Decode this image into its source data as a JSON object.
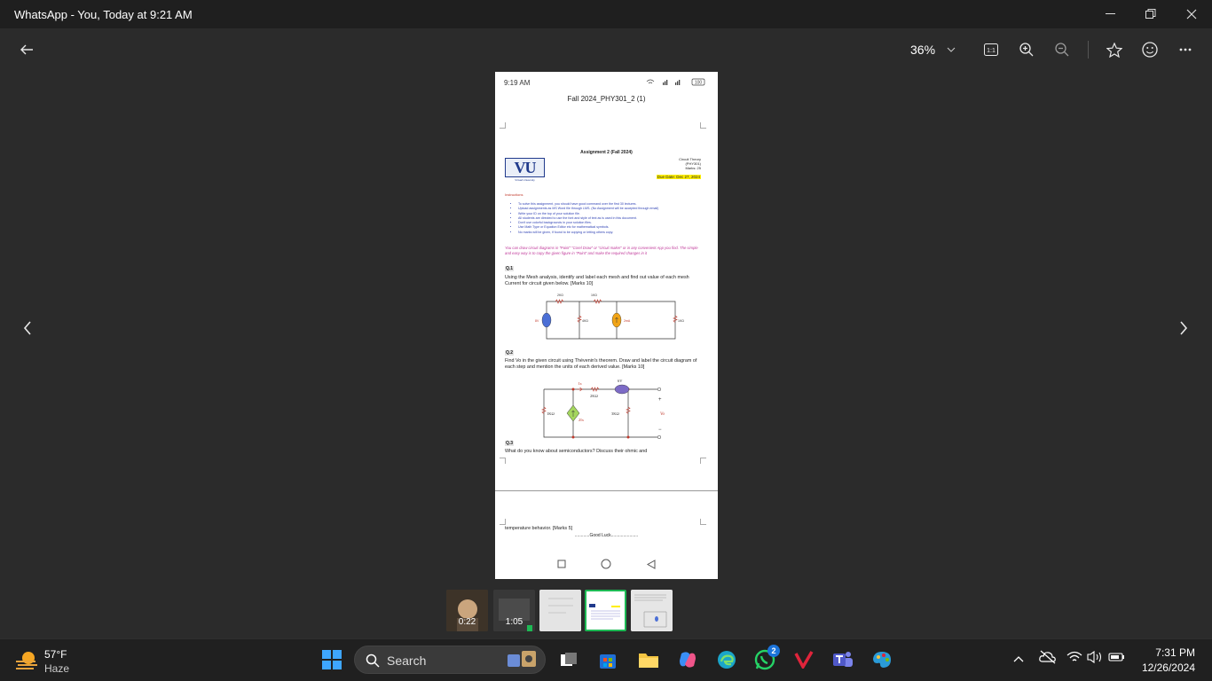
{
  "window": {
    "title": "WhatsApp - You, Today at 9:21 AM"
  },
  "toolbar": {
    "zoom": "36%"
  },
  "phone": {
    "time": "9:19 AM",
    "battery": "100",
    "doc_title": "Fall 2024_PHY301_2 (1)",
    "assignment_title": "Assignment 2 (Fall 2024)",
    "logo_text": "VU",
    "logo_sub": "Virtual University",
    "course": [
      "Circuit Theory",
      "(PHY301)",
      "Marks: 25"
    ],
    "due": "Due Date: Dec 27, 2024",
    "instructions_heading": "Instructions",
    "instructions": [
      "To solve this assignment, you should have good command over the first 30 lectures.",
      "Upload assignments as MS Word file through LMS. (No Assignment will be accepted through email)",
      "Write your ID on the top of your solution file.",
      "All students are directed to use the font and style of text as is used in this document.",
      "Don't use colorful backgrounds in your solution files.",
      "Use Math Type or Equation Editor etc for mathematical symbols.",
      "No marks will be given, if found to be copying or letting others copy."
    ],
    "note": "You can draw circuit diagrams in \"Paint\" \"Corel Draw\" or \"circuit maker\" or in any convenient App you find. The simple and easy way is to copy the given figure in \"Paint\" and make the required changes in it",
    "q1_heading": "Q.1",
    "q1_text": "Using the Mesh analysis, identify and label each mesh and find out value of each mesh Current for circuit given below.                  [Marks 10]",
    "c1": {
      "r1": "2KΩ",
      "r2": "1KΩ",
      "v": "8V",
      "r3": "4KΩ",
      "i": "2mA",
      "r4": "1KΩ"
    },
    "q2_heading": "Q.2",
    "q2_text": "Find Vo in the given circuit using Thévenin's theorem. Draw and label the circuit diagram of each step and mention the units of each derived value. [Marks 10]",
    "c2": {
      "ix": "Ix",
      "r1": "2KΩ",
      "v": "6V",
      "r2": "1KΩ",
      "dep": "2Ix",
      "r3": "3KΩ",
      "vo": "Vo",
      "plus": "+",
      "minus": "−"
    },
    "q3_heading": "Q.3",
    "q3_text": "What do you know about semiconductors? Discuss their ohmic and",
    "q3_cont": "temperature behavior.  [Marks 5]",
    "good_luck": "............Good Luck......................"
  },
  "thumbnails": [
    {
      "duration": "0:22",
      "kind": "video"
    },
    {
      "duration": "1:05",
      "kind": "video"
    },
    {
      "duration": "",
      "kind": "image"
    },
    {
      "duration": "",
      "kind": "image",
      "selected": true
    },
    {
      "duration": "",
      "kind": "image"
    }
  ],
  "taskbar": {
    "temp": "57°F",
    "condition": "Haze",
    "search_label": "Search",
    "whatsapp_badge": "2",
    "time": "7:31 PM",
    "date": "12/26/2024"
  },
  "colors": {
    "accent_thumb": "#1db954",
    "due_highlight": "#ffef00",
    "instructions": "#2c3fb3"
  }
}
